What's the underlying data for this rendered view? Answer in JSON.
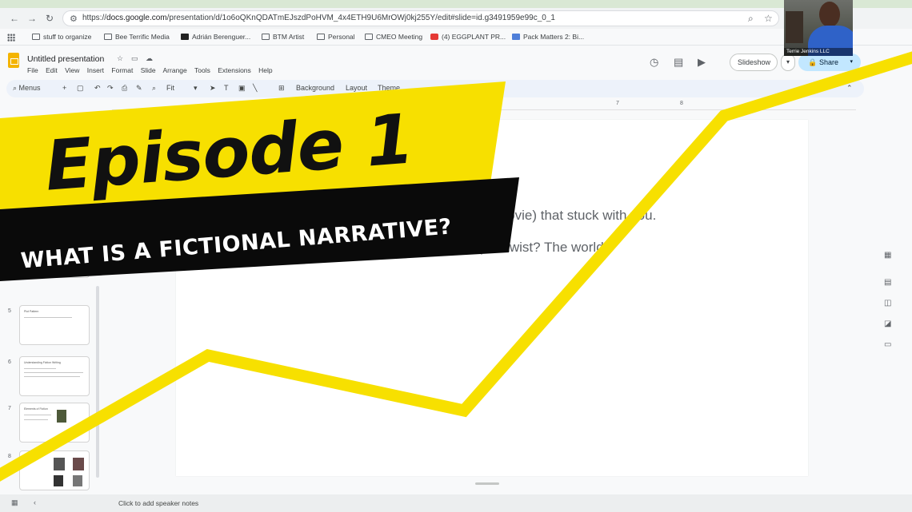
{
  "browser": {
    "url_prefix": "https://",
    "url_host": "docs.google.com",
    "url_path": "/presentation/d/1o6oQKnQDATmEJszdPoHVM_4x4ETH9U6MrOWj0kj255Y/edit#slide=id.g3491959e99c_0_1",
    "bookmarks": [
      "stuff to organize",
      "Bee Terrific Media",
      "Adrián Berenguer...",
      "BTM Artist",
      "Personal",
      "CMEO Meeting",
      "(4) EGGPLANT PR...",
      "Pack Matters 2: Bi..."
    ]
  },
  "app": {
    "doc_title": "Untitled presentation",
    "menus": [
      "File",
      "Edit",
      "View",
      "Insert",
      "Format",
      "Slide",
      "Arrange",
      "Tools",
      "Extensions",
      "Help"
    ],
    "slideshow_label": "Slideshow",
    "share_label": "Share"
  },
  "toolbar": {
    "menus_label": "Menus",
    "zoom_label": "Fit",
    "background_label": "Background",
    "layout_label": "Layout",
    "theme_label": "Theme"
  },
  "ruler": [
    "7",
    "8"
  ],
  "filmstrip": {
    "slides": [
      {
        "number": "5",
        "title": "Plot Pattern"
      },
      {
        "number": "6",
        "title": "Understanding Fiction Writing"
      },
      {
        "number": "7",
        "title": "Elements of Fiction"
      },
      {
        "number": "8",
        "title": ""
      }
    ]
  },
  "slide": {
    "line1": "movie) that stuck with you.",
    "line2": "plot twist? The world?"
  },
  "notes": {
    "placeholder": "Click to add speaker notes"
  },
  "webcam": {
    "name": "Terrie Jenkins LLC"
  },
  "overlay": {
    "title": "Episode 1",
    "subtitle": "WHAT IS A FICTIONAL NARRATIVE?",
    "accent_color": "#f7e000",
    "band_color": "#0a0a0a"
  }
}
